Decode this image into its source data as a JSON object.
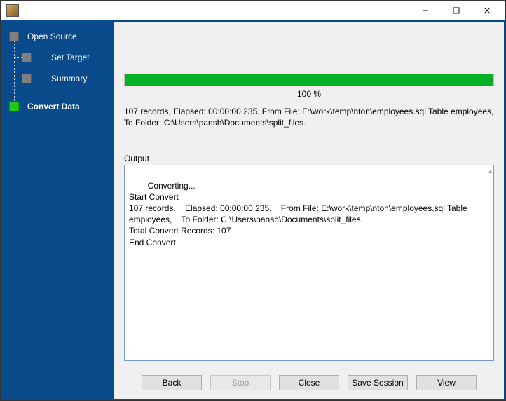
{
  "sidebar": {
    "items": [
      {
        "label": "Open Source",
        "active": false
      },
      {
        "label": "Set Target",
        "active": false
      },
      {
        "label": "Summary",
        "active": false
      },
      {
        "label": "Convert Data",
        "active": true
      }
    ]
  },
  "progress": {
    "percent": 100,
    "label": "100 %"
  },
  "summary": "107 records,    Elapsed: 00:00:00.235.    From File: E:\\work\\temp\\nton\\employees.sql Table employees,    To Folder: C:\\Users\\pansh\\Documents\\split_files.",
  "output": {
    "label": "Output",
    "text": "Converting...\nStart Convert\n107 records,    Elapsed: 00:00:00.235.    From File: E:\\work\\temp\\nton\\employees.sql Table employees,    To Folder: C:\\Users\\pansh\\Documents\\split_files.\nTotal Convert Records: 107\nEnd Convert\n"
  },
  "buttons": {
    "back": "Back",
    "stop": "Stop",
    "close": "Close",
    "save_session": "Save Session",
    "view": "View"
  }
}
